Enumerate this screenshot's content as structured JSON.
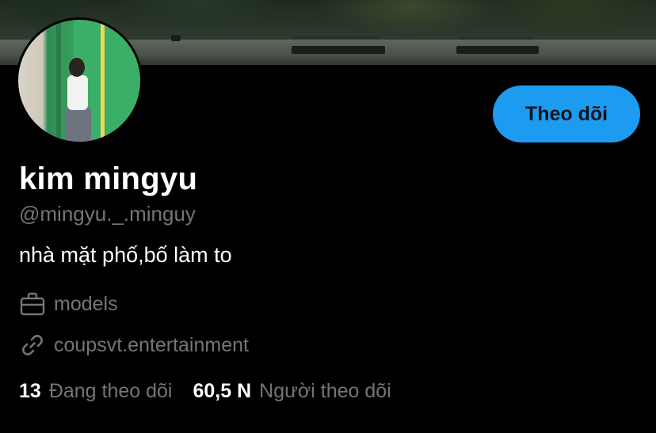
{
  "profile": {
    "name": "kim mingyu",
    "handle": "@mingyu._.minguy",
    "bio": "nhà mặt phố,bố làm to",
    "work": "models",
    "link": "coupsvt.entertainment"
  },
  "actions": {
    "follow_label": "Theo dõi"
  },
  "stats": {
    "following_count": "13",
    "following_label": "Đang theo dõi",
    "followers_count": "60,5 N",
    "followers_label": "Người theo dõi"
  },
  "icons": {
    "work": "briefcase-icon",
    "link": "link-icon"
  },
  "colors": {
    "accent": "#1d9bf0",
    "muted_text": "#71767b",
    "background": "#000000"
  }
}
